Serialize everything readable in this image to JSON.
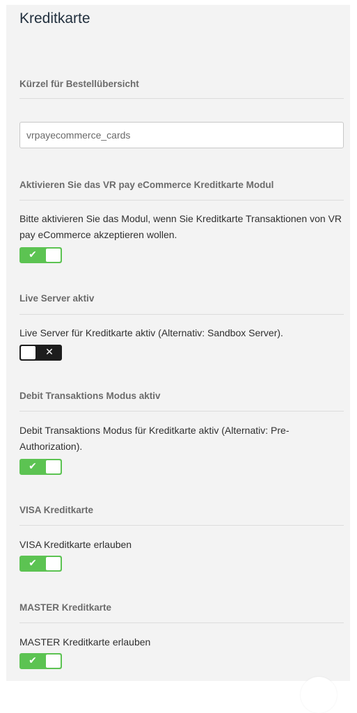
{
  "title": "Kreditkarte",
  "shortcode": {
    "label": "Kürzel für Bestellübersicht",
    "value": "vrpayecommerce_cards"
  },
  "sections": [
    {
      "id": "activate",
      "heading": "Aktivieren Sie das VR pay eCommerce Kreditkarte Modul",
      "description": "Bitte aktivieren Sie das Modul, wenn Sie Kreditkarte Transaktionen von VR pay eCommerce akzeptieren wollen.",
      "enabled": true,
      "icon": "check-icon"
    },
    {
      "id": "live-server",
      "heading": "Live Server aktiv",
      "description": "Live Server für Kreditkarte aktiv (Alternativ: Sandbox Server).",
      "enabled": false,
      "icon": "close-icon"
    },
    {
      "id": "debit-mode",
      "heading": "Debit Transaktions Modus aktiv",
      "description": "Debit Transaktions Modus für Kreditkarte aktiv (Alternativ: Pre-Authorization).",
      "enabled": true,
      "icon": "check-icon"
    },
    {
      "id": "visa",
      "heading": "VISA Kreditkarte",
      "description": "VISA Kreditkarte erlauben",
      "enabled": true,
      "icon": "check-icon"
    },
    {
      "id": "master",
      "heading": "MASTER Kreditkarte",
      "description": "MASTER Kreditkarte erlauben",
      "enabled": true,
      "icon": "check-icon"
    }
  ],
  "colors": {
    "toggle_on": "#5cc352",
    "toggle_off": "#1d1d1d",
    "panel_bg": "#f3f3f3"
  }
}
